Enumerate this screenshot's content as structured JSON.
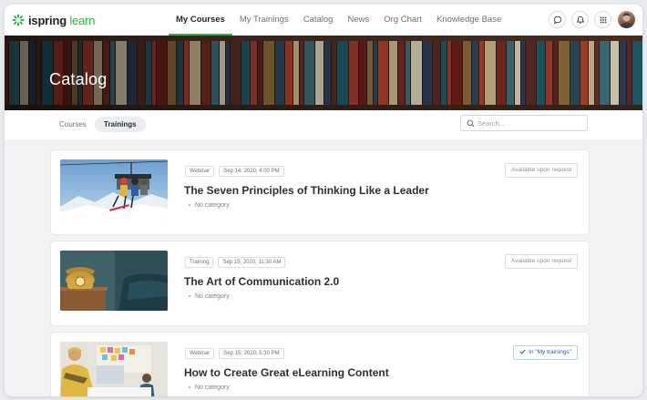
{
  "app": {
    "logo_bold": "ispring",
    "logo_light": "learn"
  },
  "nav": {
    "items": [
      {
        "label": "My Courses",
        "active": true
      },
      {
        "label": "My Trainings",
        "active": false
      },
      {
        "label": "Catalog",
        "active": false
      },
      {
        "label": "News",
        "active": false
      },
      {
        "label": "Org Chart",
        "active": false
      },
      {
        "label": "Knowledge Base",
        "active": false
      }
    ]
  },
  "header_icons": [
    "chat-icon",
    "bell-icon",
    "apps-grid-icon"
  ],
  "page": {
    "title": "Catalog"
  },
  "filters": {
    "tabs": [
      {
        "label": "Courses",
        "active": false
      },
      {
        "label": "Trainings",
        "active": true
      }
    ],
    "search_placeholder": "Search..."
  },
  "trainings": [
    {
      "type": "Webinar",
      "date": "Sep 14, 2020, 4:00 PM",
      "title": "The Seven Principles of Thinking Like a Leader",
      "category": "No category",
      "status": "Available upon request",
      "enrolled": false
    },
    {
      "type": "Training",
      "date": "Sep 15, 2020, 11:30 AM",
      "title": "The Art of Communication 2.0",
      "category": "No category",
      "status": "Available upon request",
      "enrolled": false
    },
    {
      "type": "Webinar",
      "date": "Sep 15, 2020, 5:30 PM",
      "title": "How to Create Great eLearning Content",
      "category": "No category",
      "status": "In \"My trainings\"",
      "enrolled": true
    }
  ],
  "colors": {
    "accent": "#2fb344",
    "enrolled": "#2b5fb5"
  }
}
